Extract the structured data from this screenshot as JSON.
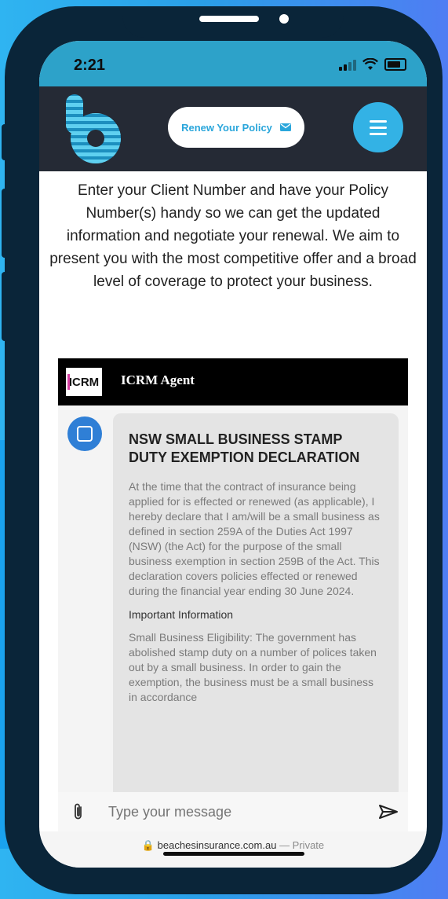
{
  "status": {
    "time": "2:21"
  },
  "site": {
    "renew_label": "Renew Your Policy",
    "intro": "Enter your Client Number and have your Policy Number(s) handy so we can get the updated information and negotiate your renewal. We aim to present you with the most competitive offer and a broad level of coverage to protect your business."
  },
  "chat": {
    "logo_text": "ICRM",
    "title": "ICRM Agent",
    "message": {
      "heading": "NSW SMALL BUSINESS STAMP DUTY EXEMPTION DECLARATION",
      "body": "At the time that the contract of insurance being applied for is effected or renewed (as applicable), I hereby declare that I am/will be a small business as defined in section 259A of the Duties Act 1997 (NSW) (the Act) for the purpose of the small business exemption in section 259B of the Act. This declaration covers policies effected or renewed during the financial year ending 30 June 2024.",
      "subheading": "Important Information",
      "body2": "Small Business Eligibility: The government has abolished stamp duty on a number of polices taken out by a small business. In order to gain the exemption, the business must be a small business in accordance"
    },
    "input_placeholder": "Type your message"
  },
  "browser": {
    "url": "beachesinsurance.com.au",
    "privacy": "— Private"
  },
  "colors": {
    "accent": "#33b2e5",
    "header_bg": "#252a35",
    "status_bg": "#2da2c9"
  }
}
